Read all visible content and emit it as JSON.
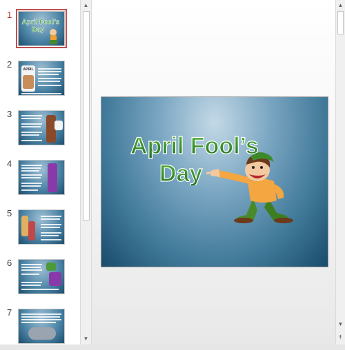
{
  "slides": [
    {
      "number": "1",
      "active": true
    },
    {
      "number": "2",
      "active": false
    },
    {
      "number": "3",
      "active": false
    },
    {
      "number": "4",
      "active": false
    },
    {
      "number": "5",
      "active": false
    },
    {
      "number": "6",
      "active": false
    },
    {
      "number": "7",
      "active": false
    }
  ],
  "main_slide": {
    "title_line1": "April Fool’s",
    "title_line2": "Day"
  },
  "thumb_slide1": {
    "title_line1": "April Fool’s",
    "title_line2": "Day"
  },
  "thumb_slide2": {
    "heading": "APRIL"
  },
  "colors": {
    "selected_outline": "#c0504d",
    "selected_number": "#c0392b",
    "title_green": "#2e8b2e"
  },
  "icons": [
    "scroll-up-arrow-icon",
    "scroll-down-arrow-icon",
    "page-up-icon"
  ]
}
